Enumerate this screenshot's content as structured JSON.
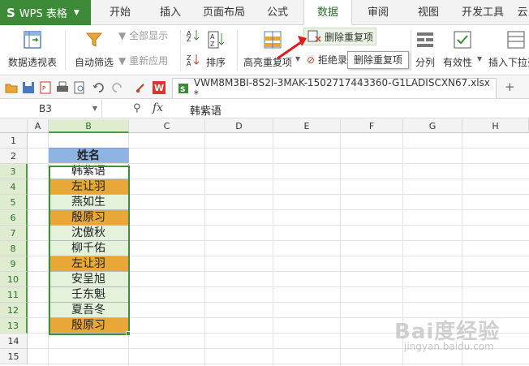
{
  "app": {
    "name": "WPS 表格",
    "logo": "S"
  },
  "menu": {
    "tabs": [
      "开始",
      "插入",
      "页面布局",
      "公式",
      "数据",
      "审阅",
      "视图",
      "开发工具",
      "云"
    ],
    "active": "数据"
  },
  "ribbon": {
    "pivot": "数据透视表",
    "autofilter": "自动筛选",
    "show_all": "全部显示",
    "reapply": "重新应用",
    "sort": "排序",
    "highlight_dup": "高亮重复项",
    "remove_dup": "删除重复项",
    "reject_dup": "拒绝录",
    "split": "分列",
    "validity": "有效性",
    "insert_dropdown": "插入下拉列"
  },
  "tooltip": "删除重复项",
  "document": {
    "tab_title": "VWM8M3BI-8S2I-3MAK-1502717443360-G1LADISCXN67.xlsx *"
  },
  "formula_bar": {
    "cell_ref": "B3",
    "fx_label": "fx",
    "content": "韩紫语"
  },
  "sheet": {
    "columns": [
      "A",
      "B",
      "C",
      "D",
      "E",
      "F",
      "G",
      "H"
    ],
    "rows": [
      "1",
      "2",
      "3",
      "4",
      "5",
      "6",
      "7",
      "8",
      "9",
      "10",
      "11",
      "12",
      "13",
      "14",
      "15"
    ],
    "header_cell": "姓名",
    "names": [
      "韩紫语",
      "左让羽",
      "燕如生",
      "殷原习",
      "沈傲秋",
      "柳千佑",
      "左让羽",
      "安呈旭",
      "壬东魁",
      "夏吾冬",
      "殷原习"
    ],
    "duplicate_flags": [
      false,
      true,
      false,
      true,
      false,
      false,
      true,
      false,
      false,
      false,
      true
    ],
    "colors": {
      "header": "#8db4e2",
      "duplicate": "#e8a736",
      "normal": "#e4f2dc",
      "accent": "#3c8a38"
    }
  },
  "watermark": {
    "main": "Bai度经验",
    "sub": "jingyan.baidu.com"
  }
}
